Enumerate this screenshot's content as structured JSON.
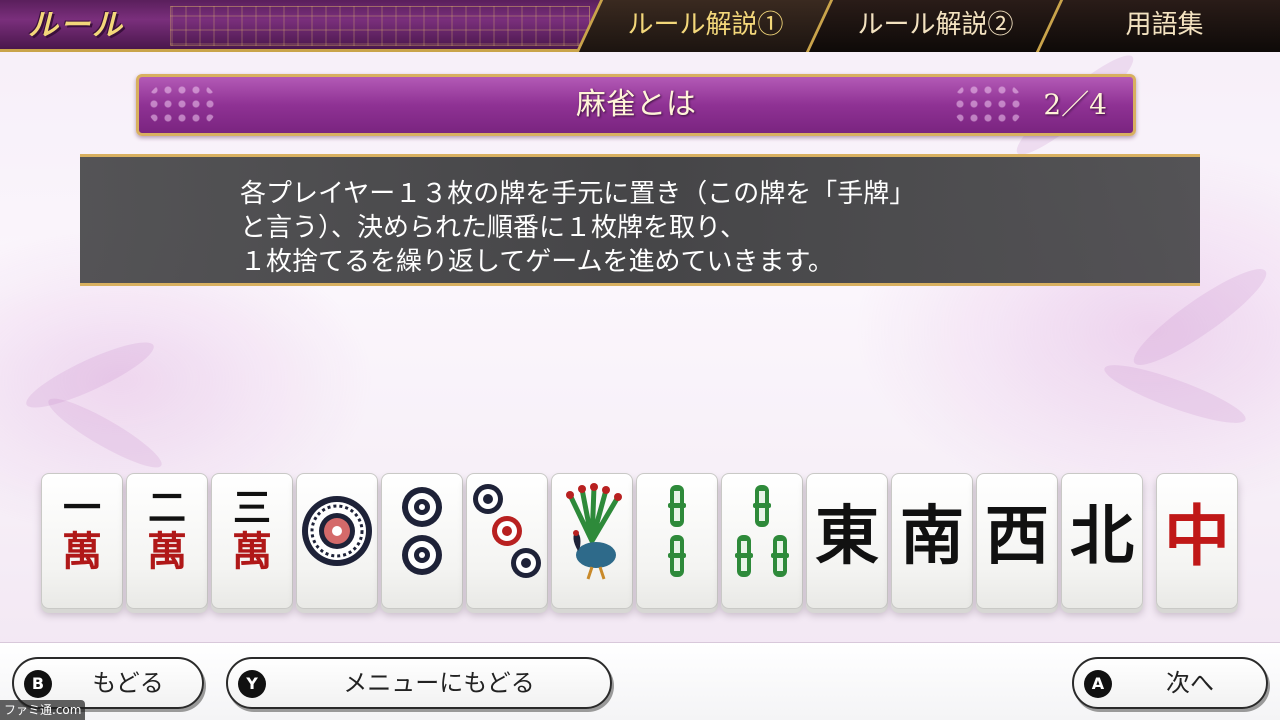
{
  "app_title": "ルール",
  "tabs": [
    {
      "label": "ルール解説①",
      "active": true
    },
    {
      "label": "ルール解説②",
      "active": false
    },
    {
      "label": "用語集",
      "active": false
    }
  ],
  "section": {
    "title": "麻雀とは",
    "page": "2／4"
  },
  "description": {
    "line1": "各プレイヤー１３枚の牌を手元に置き（この牌を「手牌」",
    "line2": "と言う）、決められた順番に１枚牌を取り、",
    "line3": "１枚捨てるを繰り返してゲームを進めていきます。"
  },
  "tiles": [
    {
      "name": "1-man",
      "top": "一",
      "bottom": "萬"
    },
    {
      "name": "2-man",
      "top": "二",
      "bottom": "萬"
    },
    {
      "name": "3-man",
      "top": "三",
      "bottom": "萬"
    },
    {
      "name": "1-pin",
      "icon": "pin-1"
    },
    {
      "name": "2-pin",
      "icon": "pin-2"
    },
    {
      "name": "3-pin",
      "icon": "pin-3"
    },
    {
      "name": "1-sou",
      "icon": "peacock-bird"
    },
    {
      "name": "2-sou",
      "icon": "sou-2"
    },
    {
      "name": "3-sou",
      "icon": "sou-3"
    },
    {
      "name": "east",
      "honor": "東"
    },
    {
      "name": "south",
      "honor": "南"
    },
    {
      "name": "west",
      "honor": "西"
    },
    {
      "name": "north",
      "honor": "北"
    },
    {
      "name": "red-dragon",
      "honor": "中"
    }
  ],
  "buttons": {
    "back": {
      "glyph": "B",
      "label": "もどる"
    },
    "menu": {
      "glyph": "Y",
      "label": "メニューにもどる"
    },
    "next": {
      "glyph": "A",
      "label": "次へ"
    }
  },
  "watermark": "ファミ通.com",
  "colors": {
    "header_purple": "#8f3294",
    "gold_trim": "#d8b060",
    "panel_gray": "#3e3e40",
    "red_character": "#b01818",
    "green_bamboo": "#2e8a3a",
    "navy_circle": "#1e2238"
  }
}
